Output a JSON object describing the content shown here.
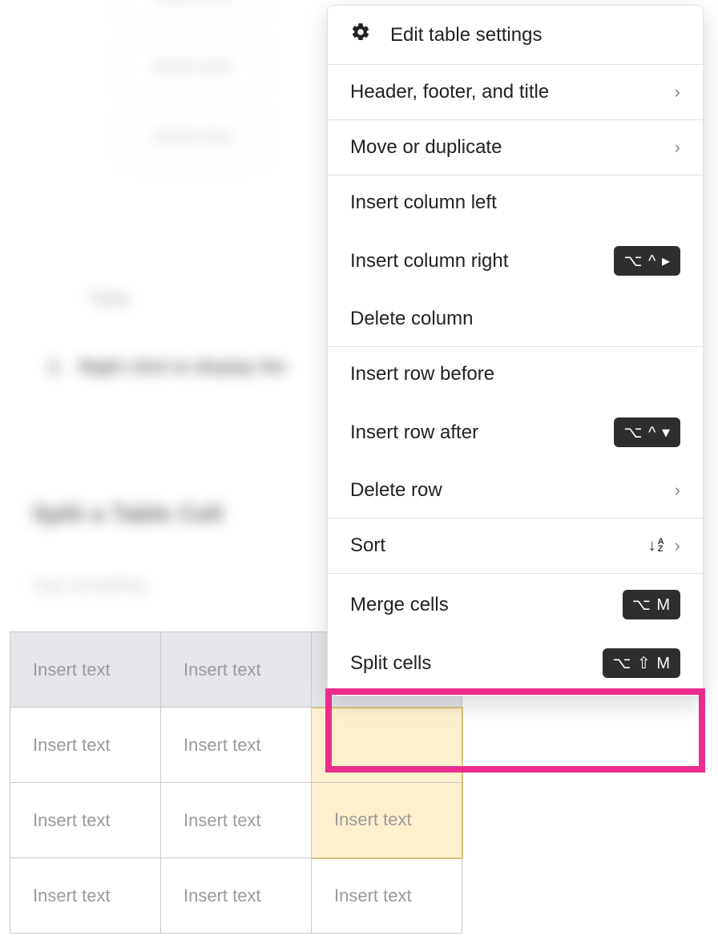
{
  "menu": {
    "edit_settings": "Edit table settings",
    "header_footer_title": "Header, footer, and title",
    "move_duplicate": "Move or duplicate",
    "insert_col_left": "Insert column left",
    "insert_col_right": "Insert column right",
    "delete_column": "Delete column",
    "insert_row_before": "Insert row before",
    "insert_row_after": "Insert row after",
    "delete_row": "Delete row",
    "sort": "Sort",
    "merge_cells": "Merge cells",
    "split_cells": "Split cells",
    "shortcuts": {
      "insert_col_right": "⌥ ^ ▸",
      "insert_row_after": "⌥ ^ ▾",
      "merge_cells": "⌥ M",
      "split_cells": "⌥ ⇧ M"
    }
  },
  "table": {
    "placeholder": "Insert text"
  },
  "bg": {
    "placeholder": "Insert text",
    "heading": "Split a Table Cell",
    "line1": "Right click to display the",
    "caption": "Table"
  }
}
